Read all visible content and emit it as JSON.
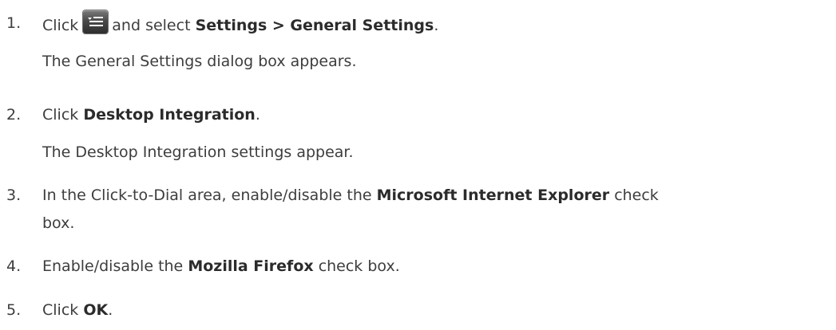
{
  "steps": [
    {
      "number": "1.",
      "prefix": "Click",
      "icon": "menu-list-icon",
      "middle": "and select",
      "bold": "Settings > General Settings",
      "suffix": ".",
      "result": "The General Settings dialog box appears."
    },
    {
      "number": "2.",
      "prefix": "Click",
      "bold": "Desktop Integration",
      "suffix": ".",
      "result": "The Desktop Integration settings appear."
    },
    {
      "number": "3.",
      "prefix": "In the Click-to-Dial area, enable/disable the",
      "bold": "Microsoft Internet Explorer",
      "suffix": "check",
      "continuation": "box."
    },
    {
      "number": "4.",
      "prefix": "Enable/disable the",
      "bold": "Mozilla Firefox",
      "suffix": "check box."
    },
    {
      "number": "5.",
      "prefix": "Click",
      "bold": "OK",
      "suffix": "."
    }
  ]
}
